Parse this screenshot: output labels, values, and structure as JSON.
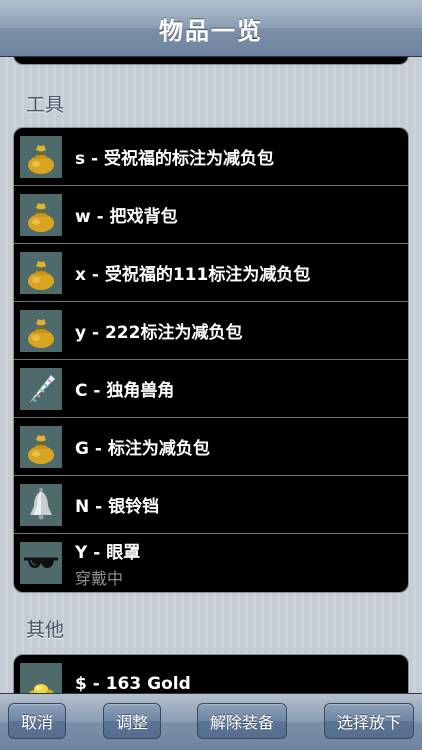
{
  "nav": {
    "title": "物品一览"
  },
  "sections": [
    {
      "header": "工具",
      "items": [
        {
          "label": "s - 受祝福的标注为减负包",
          "icon": "bag-icon"
        },
        {
          "label": "w - 把戏背包",
          "icon": "bag-icon"
        },
        {
          "label": "x - 受祝福的111标注为减负包",
          "icon": "bag-icon"
        },
        {
          "label": "y - 222标注为减负包",
          "icon": "bag-icon"
        },
        {
          "label": "C - 独角兽角",
          "icon": "unicorn-horn-icon"
        },
        {
          "label": "G - 标注为减负包",
          "icon": "bag-icon"
        },
        {
          "label": "N - 银铃铛",
          "icon": "silver-bell-icon"
        },
        {
          "label": "Y - 眼罩",
          "sub": "穿戴中",
          "icon": "blindfold-icon"
        }
      ]
    },
    {
      "header": "其他",
      "items": [
        {
          "label": "$ - 163 Gold",
          "icon": "gold-coins-icon"
        }
      ]
    }
  ],
  "toolbar": {
    "cancel": "取消",
    "adjust": "调整",
    "unequip": "解除装备",
    "drop": "选择放下"
  }
}
